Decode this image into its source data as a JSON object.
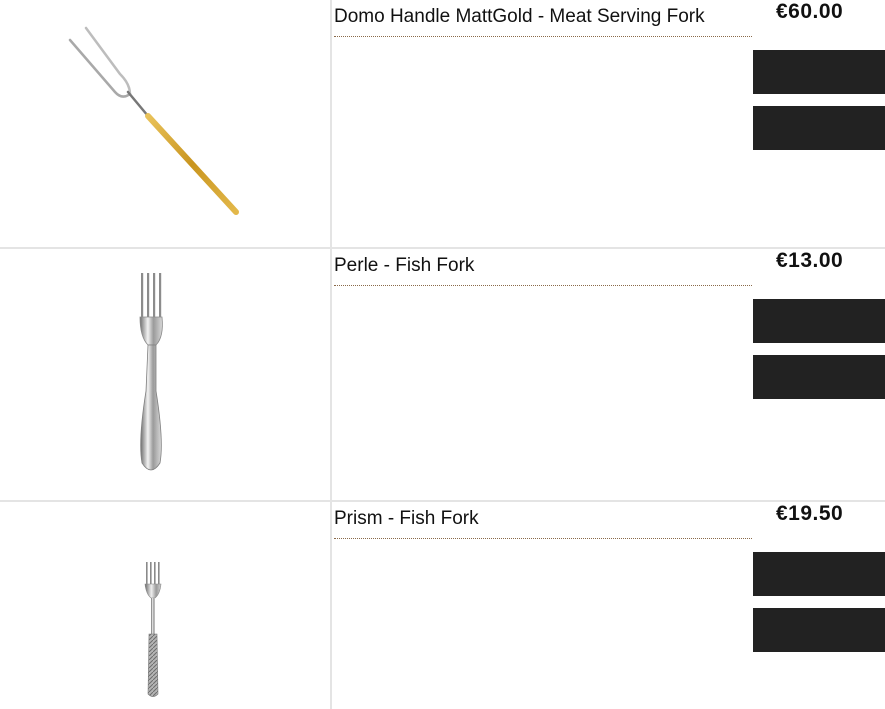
{
  "products": [
    {
      "name": "Domo Handle MattGold - Meat Serving Fork",
      "price": "€60.00",
      "image_icon": "meat-serving-fork-icon"
    },
    {
      "name": "Perle - Fish Fork",
      "price": "€13.00",
      "image_icon": "fish-fork-icon"
    },
    {
      "name": "Prism - Fish Fork",
      "price": "€19.50",
      "image_icon": "fish-fork-icon"
    }
  ],
  "colors": {
    "button": "#222222",
    "divider": "#e4e4e4",
    "name_underline": "#8a6a4a",
    "gold_handle": "#d4a52c"
  }
}
